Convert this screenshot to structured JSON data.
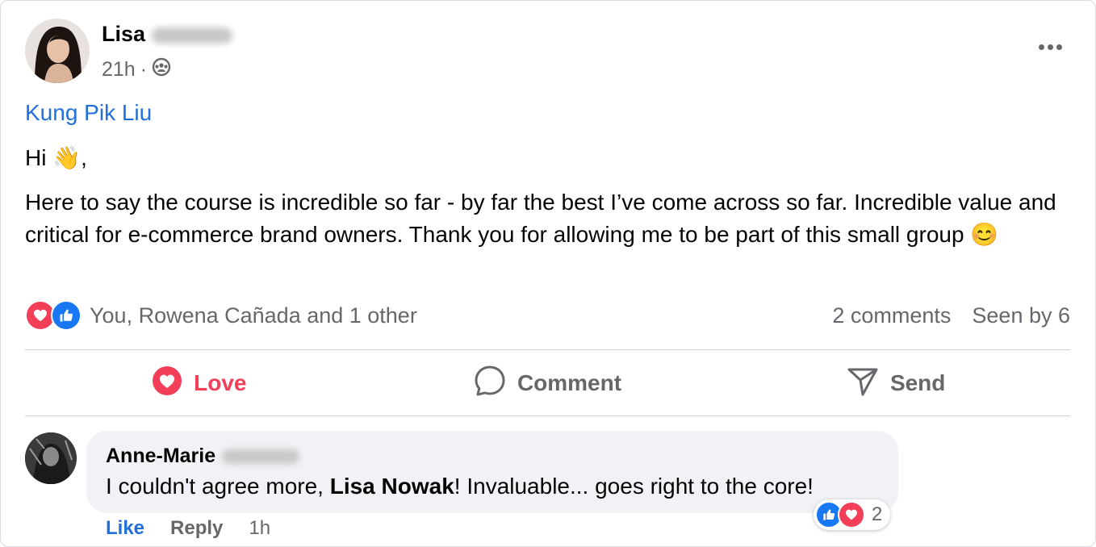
{
  "post": {
    "author_first": "Lisa",
    "time": "21h",
    "separator": "·",
    "audience_icon": "group-icon",
    "mention": "Kung Pik Liu",
    "greeting": "Hi",
    "greeting_emoji": "👋",
    "greeting_punct": ",",
    "body": "Here to say the course is incredible so far - by far the best I’ve come across so far. Incredible value and critical for e-commerce brand owners.  Thank you for allowing me to be part of this small group",
    "body_emoji": "😊"
  },
  "reactions": {
    "summary": "You, Rowena Cañada and 1 other",
    "comments": "2 comments",
    "seen": "Seen by 6",
    "icons": [
      "love-icon",
      "like-icon"
    ]
  },
  "actions": {
    "love": "Love",
    "comment": "Comment",
    "send": "Send"
  },
  "comment": {
    "author_first": "Anne-Marie",
    "text_before": "I couldn't agree more, ",
    "mention": "Lisa Nowak",
    "text_after": "! Invaluable... goes right to the core!",
    "reaction_count": "2",
    "like": "Like",
    "reply": "Reply",
    "time": "1h"
  },
  "colors": {
    "accent": "#216fdb",
    "love": "#f33e58",
    "like": "#1877f2",
    "muted": "#65676b",
    "bubble": "#f0f2f5"
  }
}
